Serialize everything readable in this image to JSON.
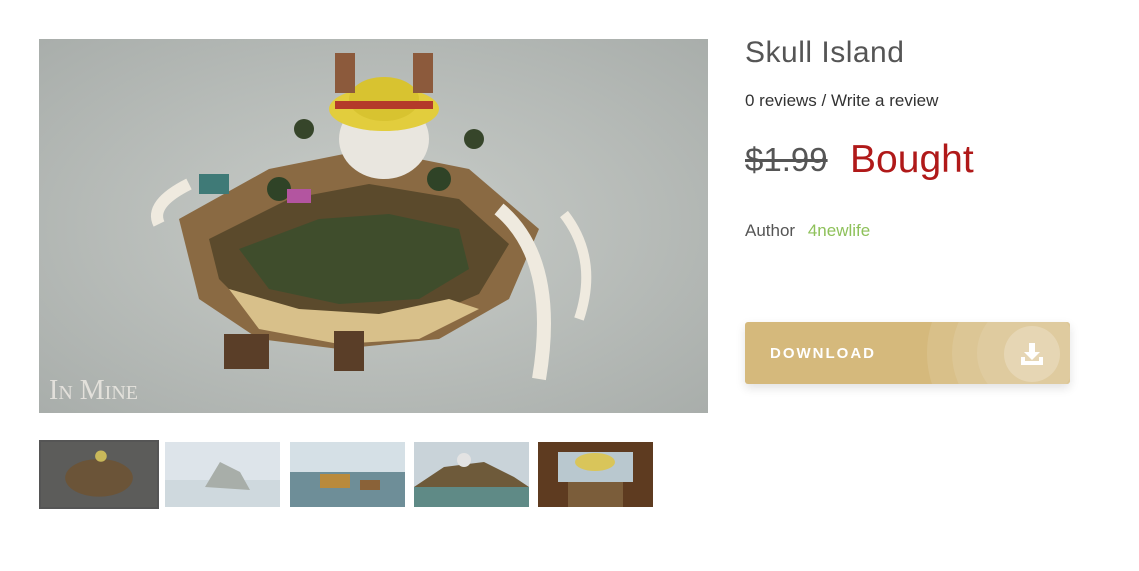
{
  "product": {
    "title": "Skull Island",
    "reviews_text": "0 reviews",
    "separator": " / ",
    "write_review": "Write a review",
    "old_price": "$1.99",
    "status": "Bought",
    "author_label": "Author",
    "author_name": "4newlife",
    "download_label": "DOWNLOAD"
  },
  "images": {
    "watermark": "In Mine",
    "thumbnails": [
      "Skull Island aerial view",
      "Skull Island foggy view",
      "Skull Island ships view",
      "Skull Island village view",
      "Skull Island interior view"
    ]
  },
  "colors": {
    "status": "#b01919",
    "author_link": "#8ec15a",
    "button": "#d5b97c"
  },
  "icons": {
    "download": "download-icon"
  }
}
